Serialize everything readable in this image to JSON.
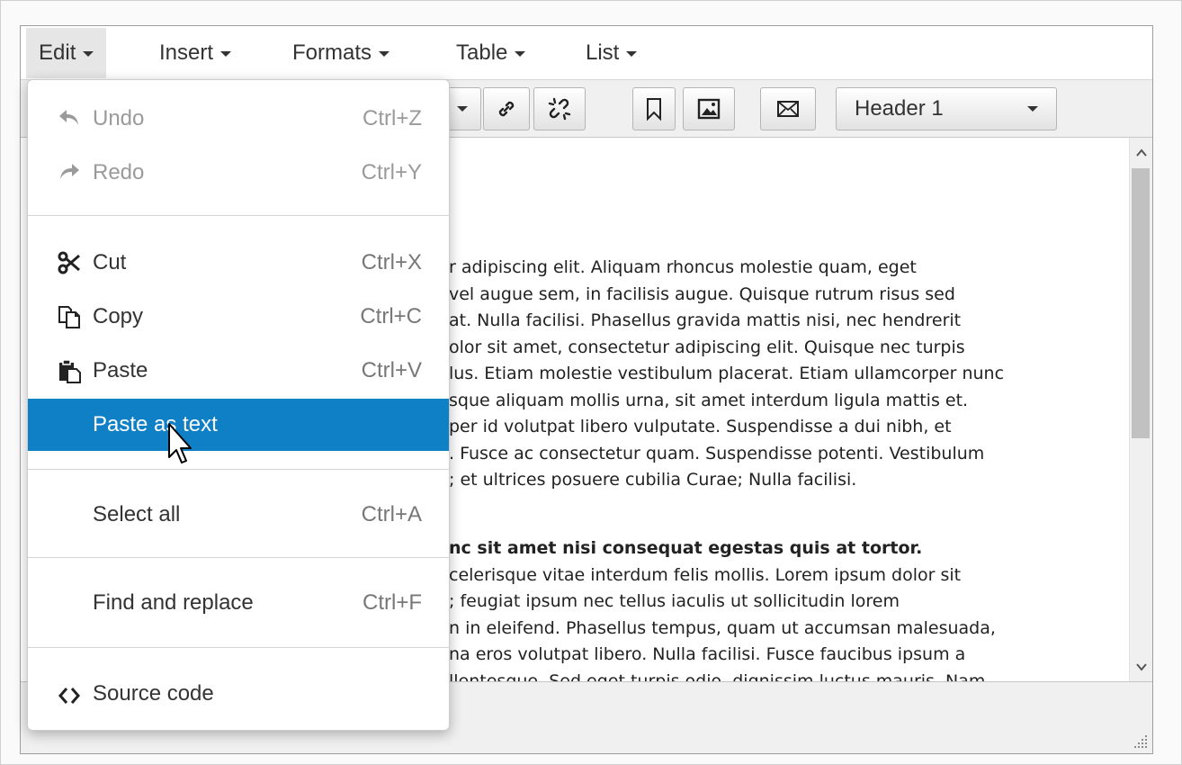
{
  "menubar": {
    "items": [
      {
        "label": "Edit"
      },
      {
        "label": "Insert"
      },
      {
        "label": "Formats"
      },
      {
        "label": "Table"
      },
      {
        "label": "List"
      }
    ]
  },
  "toolbar": {
    "block_format": "Header 1",
    "icons": [
      "link-icon",
      "unlink-icon",
      "bookmark-icon",
      "image-icon",
      "mail-icon"
    ]
  },
  "edit_menu": {
    "items": [
      {
        "label": "Undo",
        "shortcut": "Ctrl+Z",
        "icon": "undo-icon",
        "disabled": true
      },
      {
        "label": "Redo",
        "shortcut": "Ctrl+Y",
        "icon": "redo-icon",
        "disabled": true
      },
      {
        "label": "Cut",
        "shortcut": "Ctrl+X",
        "icon": "cut-icon"
      },
      {
        "label": "Copy",
        "shortcut": "Ctrl+C",
        "icon": "copy-icon"
      },
      {
        "label": "Paste",
        "shortcut": "Ctrl+V",
        "icon": "paste-icon"
      },
      {
        "label": "Paste as text",
        "shortcut": "",
        "selected": true
      },
      {
        "label": "Select all",
        "shortcut": "Ctrl+A"
      },
      {
        "label": "Find and replace",
        "shortcut": "Ctrl+F"
      },
      {
        "label": "Source code",
        "shortcut": "",
        "icon": "code-icon"
      }
    ]
  },
  "content": {
    "paragraph1": [
      "r adipiscing elit. Aliquam rhoncus molestie quam, eget",
      " vel augue sem, in facilisis augue. Quisque rutrum risus sed",
      "at. Nulla facilisi. Phasellus gravida mattis nisi, nec hendrerit",
      "olor sit amet, consectetur adipiscing elit. Quisque nec turpis",
      "lus. Etiam molestie vestibulum placerat. Etiam ullamcorper nunc",
      "sque aliquam mollis urna, sit amet interdum ligula mattis et.",
      "per id volutpat libero vulputate. Suspendisse a dui nibh, et",
      ". Fusce ac consectetur quam. Suspendisse potenti. Vestibulum",
      "; et ultrices posuere cubilia Curae; Nulla facilisi."
    ],
    "paragraph2": [
      "nc sit amet nisi consequat egestas quis at tortor.",
      "celerisque vitae interdum felis mollis. Lorem ipsum dolor sit",
      "; feugiat ipsum nec tellus iaculis ut sollicitudin lorem",
      "n in eleifend. Phasellus tempus, quam ut accumsan malesuada,",
      "na eros volutpat libero. Nulla facilisi. Fusce faucibus ipsum a",
      "llentesque. Sed eget turpis odio, dignissim luctus mauris. Nam"
    ]
  },
  "colors": {
    "selected_bg": "#0f7fc6",
    "menu_active_bg": "#e6e6e6",
    "toolbar_bg": "#f0f0f0"
  }
}
